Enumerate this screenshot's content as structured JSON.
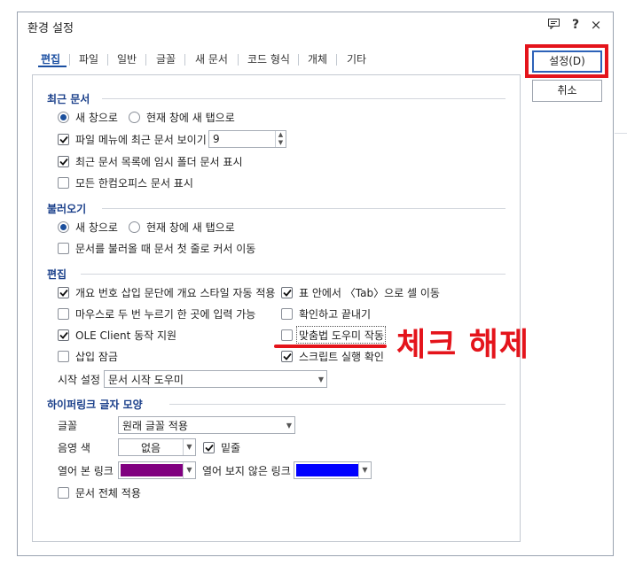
{
  "window": {
    "title": "환경 설정"
  },
  "titlebar": {
    "help_label": "?",
    "close_label": "×"
  },
  "tabs": [
    {
      "label": "편집",
      "active": true
    },
    {
      "label": "파일"
    },
    {
      "label": "일반"
    },
    {
      "label": "글꼴"
    },
    {
      "label": "새 문서"
    },
    {
      "label": "코드 형식"
    },
    {
      "label": "개체"
    },
    {
      "label": "기타"
    }
  ],
  "buttons": {
    "ok": "설정(D)",
    "cancel": "취소"
  },
  "recent": {
    "title": "최근 문서",
    "radio_new_window": "새 창으로",
    "radio_new_tab": "현재 창에 새 탭으로",
    "show_recent": "파일 메뉴에 최근 문서 보이기",
    "recent_count": "9",
    "show_temp": "최근 문서 목록에 임시 폴더 문서 표시",
    "show_all_hancom": "모든 한컴오피스 문서 표시"
  },
  "open": {
    "title": "불러오기",
    "radio_new_window": "새 창으로",
    "radio_new_tab": "현재 창에 새 탭으로",
    "cursor_first_line": "문서를 불러올 때 문서 첫 줄로 커서 이동"
  },
  "edit": {
    "title": "편집",
    "auto_outline": "개요 번호 삽입 문단에 개요 스타일 자동 적용",
    "tab_move_cell": "표 안에서 〈Tab〉으로 셀 이동",
    "double_click_input": "마우스로 두 번 누르기 한 곳에 입력 가능",
    "confirm_exit": "확인하고 끝내기",
    "ole_client": "OLE Client 동작 지원",
    "spell_helper": "맞춤법 도우미 작동",
    "insert_lock": "삽입 잠금",
    "script_confirm": "스크립트 실행 확인",
    "start_label": "시작 설정",
    "start_value": "문서 시작 도우미"
  },
  "hyperlink": {
    "title": "하이퍼링크 글자 모양",
    "font_label": "글꼴",
    "font_value": "원래 글꼴 적용",
    "shade_label": "음영 색",
    "shade_value": "없음",
    "underline": "밑줄",
    "visited_label": "열어 본 링크",
    "visited_color": "#800080",
    "unvisited_label": "열어 보지 않은 링크",
    "unvisited_color": "#0000ff",
    "apply_all": "문서 전체 적용"
  },
  "annotation": {
    "text": "체크 해제",
    "color": "#e4141b"
  }
}
